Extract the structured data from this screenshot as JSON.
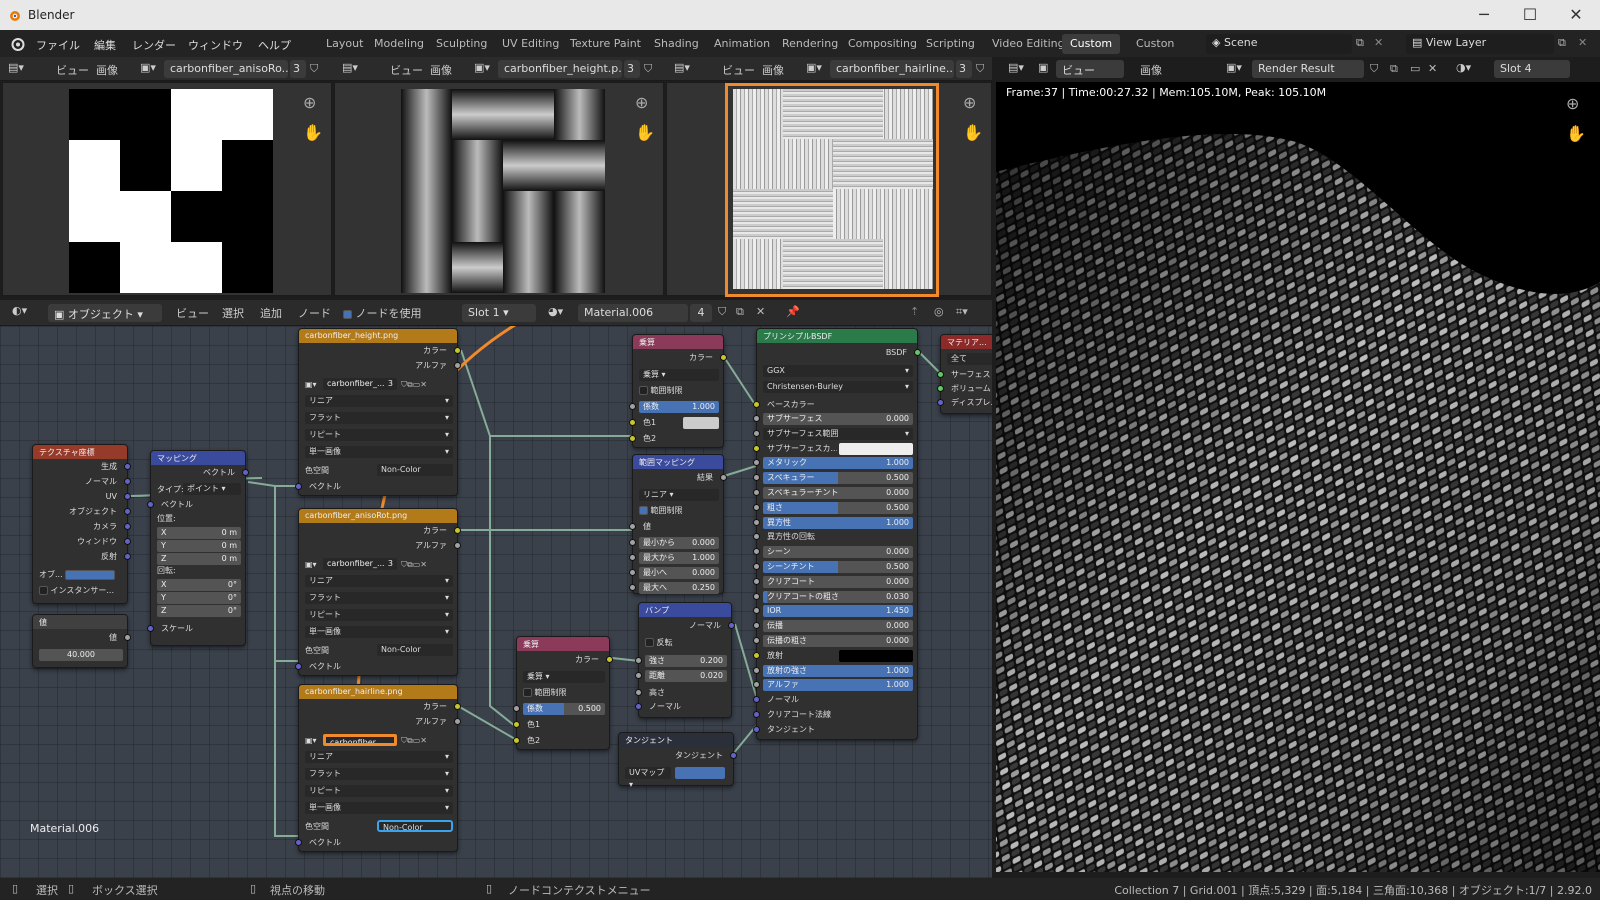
{
  "window": {
    "title": "Blender",
    "minimize": "─",
    "maximize": "☐",
    "close": "✕"
  },
  "menus": [
    "ファイル",
    "編集",
    "レンダー",
    "ウィンドウ",
    "ヘルプ"
  ],
  "workspaces": [
    "Layout",
    "Modeling",
    "Sculpting",
    "UV Editing",
    "Texture Paint",
    "Shading",
    "Animation",
    "Rendering",
    "Compositing",
    "Scripting",
    "Video Editing",
    "Custom",
    "Custon"
  ],
  "active_workspace": "Custom",
  "scene": "Scene",
  "view_layer": "View Layer",
  "image_editors": [
    {
      "view_label": "ビュー",
      "image_label": "画像",
      "image_name": "carbonfiber_anisoRo...",
      "users": "3"
    },
    {
      "view_label": "ビュー",
      "image_label": "画像",
      "image_name": "carbonfiber_height.p...",
      "users": "3"
    },
    {
      "view_label": "ビュー",
      "image_label": "画像",
      "image_name": "carbonfiber_hairline...",
      "users": "3"
    }
  ],
  "render_view": {
    "view_label": "ビュー",
    "image_label": "画像",
    "image_name": "Render Result",
    "slot": "Slot 4",
    "info": "Frame:37 | Time:00:27.32 | Mem:105.10M, Peak: 105.10M"
  },
  "node_header": {
    "mode": "オブジェクト",
    "view": "ビュー",
    "select": "選択",
    "add": "追加",
    "node": "ノード",
    "use_nodes": "ノードを使用",
    "slot": "Slot 1",
    "material": "Material.006",
    "users": "4"
  },
  "node_editor_label": "Material.006",
  "nodes": {
    "texcoord": {
      "title": "テクスチャ座標",
      "outputs": [
        "生成",
        "ノーマル",
        "UV",
        "オブジェクト",
        "カメラ",
        "ウィンドウ",
        "反射"
      ],
      "object_label": "オブ...",
      "instancer": "インスタンサー..."
    },
    "value": {
      "title": "値",
      "output": "値",
      "value": "40.000"
    },
    "mapping": {
      "title": "マッピング",
      "out": "ベクトル",
      "type_label": "タイプ:",
      "type": "ポイント",
      "vector": "ベクトル",
      "location": "位置:",
      "loc": [
        [
          "X",
          "0 m"
        ],
        [
          "Y",
          "0 m"
        ],
        [
          "Z",
          "0 m"
        ]
      ],
      "rotation": "回転:",
      "rot": [
        [
          "X",
          "0°"
        ],
        [
          "Y",
          "0°"
        ],
        [
          "Z",
          "0°"
        ]
      ],
      "scale": "スケール"
    },
    "img_height": {
      "title": "carbonfiber_height.png",
      "color": "カラー",
      "alpha": "アルファ",
      "img": "carbonfiber_...",
      "users": "3",
      "interp": "リニア",
      "proj": "フラット",
      "ext": "リピート",
      "src": "単一画像",
      "cs_label": "色空間",
      "cs": "Non-Color",
      "vec": "ベクトル"
    },
    "img_aniso": {
      "title": "carbonfiber_anisoRot.png",
      "color": "カラー",
      "alpha": "アルファ",
      "img": "carbonfiber_...",
      "users": "3",
      "interp": "リニア",
      "proj": "フラット",
      "ext": "リピート",
      "src": "単一画像",
      "cs_label": "色空間",
      "cs": "Non-Color",
      "vec": "ベクトル"
    },
    "img_hair": {
      "title": "carbonfiber_hairline.png",
      "color": "カラー",
      "alpha": "アルファ",
      "img": "carbonfiber_...",
      "users": "3",
      "interp": "リニア",
      "proj": "フラット",
      "ext": "リピート",
      "src": "単一画像",
      "cs_label": "色空間",
      "cs": "Non-Color",
      "vec": "ベクトル"
    },
    "mult1": {
      "title": "乗算",
      "out": "カラー",
      "op": "乗算",
      "clamp": "範囲制限",
      "fac_label": "係数",
      "fac": "1.000",
      "c1": "色1",
      "c2": "色2"
    },
    "maprange": {
      "title": "範囲マッピング",
      "out": "結果",
      "interp": "リニア",
      "clamp": "範囲制限",
      "val": "値",
      "rows": [
        [
          "最小から",
          "0.000"
        ],
        [
          "最大から",
          "1.000"
        ],
        [
          "最小へ",
          "0.000"
        ],
        [
          "最大へ",
          "0.250"
        ]
      ]
    },
    "mult2": {
      "title": "乗算",
      "out": "カラー",
      "op": "乗算",
      "clamp": "範囲制限",
      "fac_label": "係数",
      "fac": "0.500",
      "c1": "色1",
      "c2": "色2"
    },
    "bump": {
      "title": "バンプ",
      "out": "ノーマル",
      "invert": "反転",
      "strength_label": "強さ",
      "strength": "0.200",
      "distance_label": "距離",
      "distance": "0.020",
      "height": "高さ",
      "normal": "ノーマル"
    },
    "tangent": {
      "title": "タンジェント",
      "out": "タンジェント",
      "dir": "UVマップ"
    },
    "bsdf": {
      "title": "プリンシプルBSDF",
      "out": "BSDF",
      "dist": "GGX",
      "sss_method": "Christensen-Burley",
      "base": "ベースカラー",
      "rows": [
        [
          "サブサーフェス",
          "0.000",
          0
        ],
        [
          "サブサーフェス範囲",
          "",
          2
        ],
        [
          "サブサーフェスカ...",
          "",
          3
        ],
        [
          "メタリック",
          "1.000",
          1
        ],
        [
          "スペキュラー",
          "0.500",
          0.5
        ],
        [
          "スペキュラーチント",
          "0.000",
          0
        ],
        [
          "粗さ",
          "0.500",
          0.5
        ],
        [
          "異方性",
          "1.000",
          1
        ],
        [
          "異方性の回転",
          "",
          4
        ],
        [
          "シーン",
          "0.000",
          0
        ],
        [
          "シーンチント",
          "0.500",
          0.5
        ],
        [
          "クリアコート",
          "0.000",
          0
        ],
        [
          "クリアコートの粗さ",
          "0.030",
          0.03
        ],
        [
          "IOR",
          "1.450",
          1
        ],
        [
          "伝播",
          "0.000",
          0
        ],
        [
          "伝播の粗さ",
          "0.000",
          0
        ],
        [
          "放射",
          "",
          5
        ],
        [
          "放射の強さ",
          "1.000",
          1
        ],
        [
          "アルファ",
          "1.000",
          1
        ]
      ],
      "tail": [
        "ノーマル",
        "クリアコート法線",
        "タンジェント"
      ]
    },
    "output": {
      "title": "マテリア...",
      "target": "全て",
      "surface": "サーフェス",
      "volume": "ボリューム",
      "disp": "ディスプレ..."
    }
  },
  "status": {
    "select": "選択",
    "box": "ボックス選択",
    "pan": "視点の移動",
    "ctx": "ノードコンテクストメニュー",
    "stats": "Collection 7 | Grid.001 | 頂点:5,329 | 面:5,184 | 三角面:10,368 | オブジェクト:1/7 | 2.92.0"
  },
  "colors": {
    "accent": "#f08a2c",
    "select_blue": "#3aa3f0",
    "tex_header": "#b37a1a",
    "color_header": "#8c3a5a",
    "vector_header": "#3a4a9c",
    "shader_header": "#2a7a4a",
    "input_header": "#404040"
  }
}
